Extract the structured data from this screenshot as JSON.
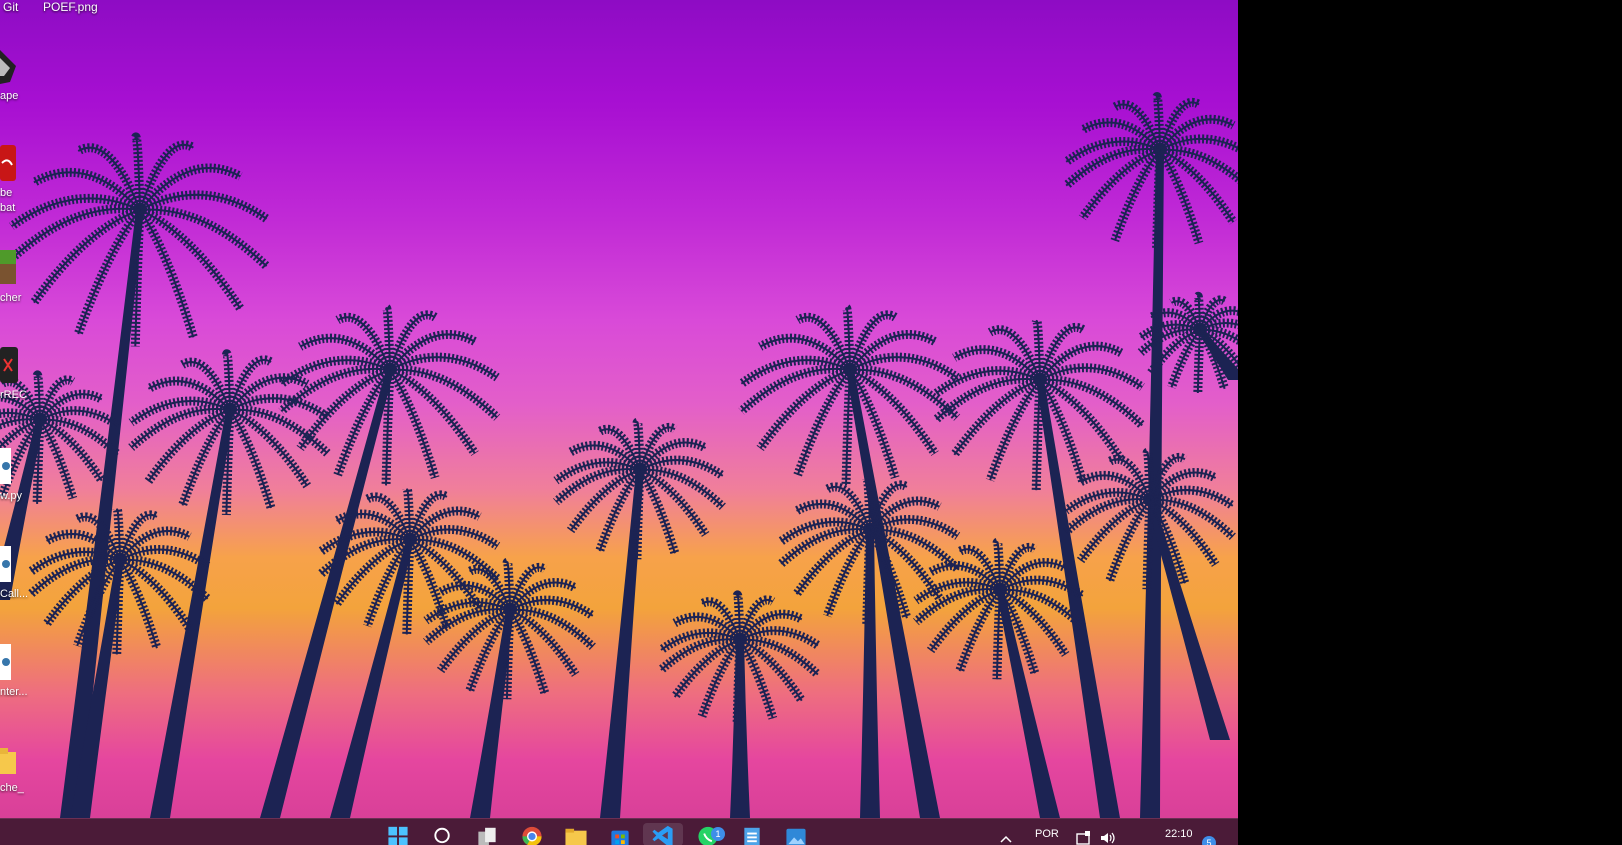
{
  "desktop": {
    "top_labels": [
      "Git",
      "POEF.png"
    ],
    "icons": [
      {
        "label": "ape",
        "icon": "inkscape-icon"
      },
      {
        "label_line1": "be",
        "label_line2": "bat",
        "icon": "acrobat-icon"
      },
      {
        "label": "cher",
        "icon": "minecraft-launcher-icon"
      },
      {
        "label": "rREC",
        "icon": "screen-recorder-icon"
      },
      {
        "label": "w.py",
        "icon": "python-file-icon"
      },
      {
        "label": "Call...",
        "icon": "python-file-icon"
      },
      {
        "label": "nter...",
        "icon": "python-file-icon"
      },
      {
        "label": "che_",
        "icon": "folder-icon"
      }
    ]
  },
  "taskbar": {
    "apps": [
      {
        "name": "start",
        "icon": "windows-start-icon"
      },
      {
        "name": "search",
        "icon": "search-icon"
      },
      {
        "name": "task-view",
        "icon": "task-view-icon"
      },
      {
        "name": "chrome",
        "icon": "chrome-icon"
      },
      {
        "name": "file-explorer",
        "icon": "folder-icon"
      },
      {
        "name": "store",
        "icon": "store-icon"
      },
      {
        "name": "vscode",
        "icon": "vscode-icon"
      },
      {
        "name": "whatsapp",
        "icon": "whatsapp-icon",
        "badge": "1"
      },
      {
        "name": "notepad",
        "icon": "notepad-icon"
      },
      {
        "name": "photos",
        "icon": "photos-icon"
      }
    ],
    "tray": {
      "language": "POR",
      "time": "22:10",
      "notification_count": "5"
    }
  },
  "colors": {
    "palm": "#1c2353",
    "taskbar": "#4b1b38"
  }
}
